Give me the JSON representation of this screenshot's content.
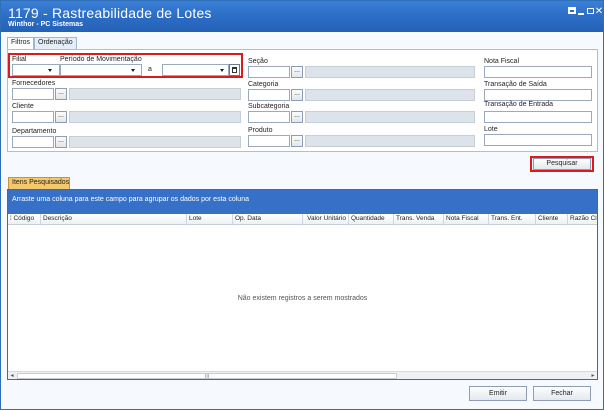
{
  "window": {
    "title": "1179 - Rastreabilidade de Lotes",
    "subtitle": "Winthor - PC Sistemas",
    "controls": [
      "restore-icon",
      "minimize-icon",
      "maximize-icon",
      "close-icon"
    ]
  },
  "tabs": [
    {
      "label": "Filtros",
      "active": true
    },
    {
      "label": "Ordenação",
      "active": false
    }
  ],
  "filters": {
    "filial_label": "Filial",
    "periodo_label": "Período de Movimentação",
    "periodo_sep": "a",
    "fornecedores_label": "Fornecedores",
    "cliente_label": "Cliente",
    "departamento_label": "Departamento",
    "secao_label": "Seção",
    "categoria_label": "Categoria",
    "subcategoria_label": "Subcategoria",
    "produto_label": "Produto",
    "nota_fiscal_label": "Nota Fiscal",
    "transacao_saida_label": "Transação de Saída",
    "transacao_entrada_label": "Transação de Entrada",
    "lote_label": "Lote",
    "lookup_button": "...",
    "search_button": "Pesquisar"
  },
  "results": {
    "tab_label": "Itens Pesquisados",
    "group_hint": "Arraste uma coluna para este campo para agrupar os dados por esta coluna",
    "columns": [
      "Código",
      "Descrição",
      "Lote",
      "Op. Data",
      "Valor Unitário",
      "Quantidade",
      "Trans. Venda",
      "Nota Fiscal",
      "Trans. Ent.",
      "Cliente",
      "Razão Cl"
    ],
    "empty_message": "Não existem registros a serem mostrados",
    "scroll_grip": "III"
  },
  "footer": {
    "emit_label": "Emitir",
    "close_label": "Fechar"
  },
  "colors": {
    "titlebar": "#2b6cc4",
    "highlight": "#d91b1b",
    "group_bar": "#3671c7",
    "results_tab": "#f5c86b"
  }
}
